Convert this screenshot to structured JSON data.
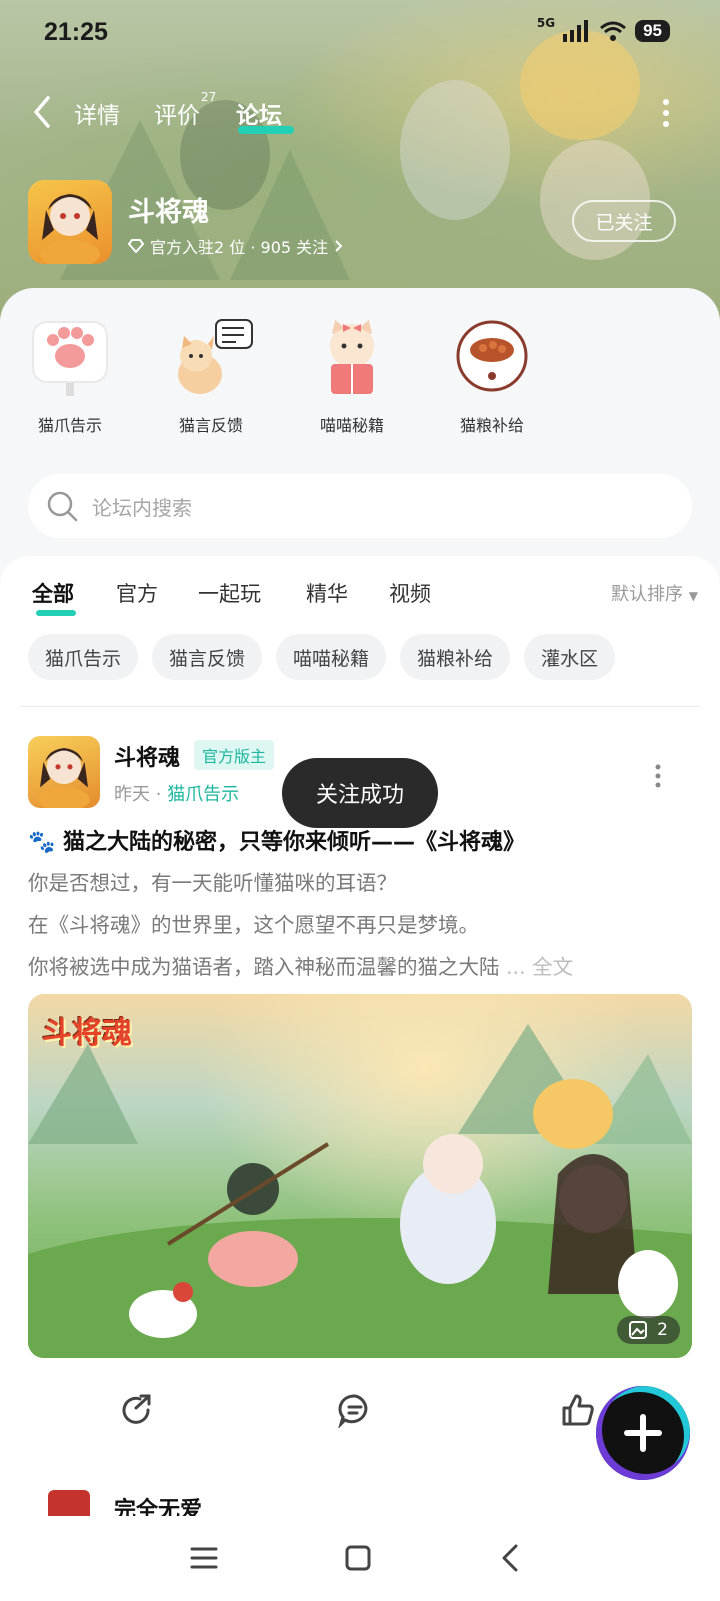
{
  "status_bar": {
    "time": "21:25",
    "network": "5G",
    "battery": "95"
  },
  "nav": {
    "tabs": [
      {
        "label": "详情"
      },
      {
        "label": "评价",
        "badge": "27"
      },
      {
        "label": "论坛"
      }
    ],
    "active_tab": "论坛"
  },
  "game": {
    "title": "斗将魂",
    "meta": "官方入驻2 位 · 905 关注",
    "follow_button": "已关注"
  },
  "shortcuts": [
    {
      "label": "猫爪告示",
      "icon": "cat-paw-sign-icon"
    },
    {
      "label": "猫言反馈",
      "icon": "cat-feedback-icon"
    },
    {
      "label": "喵喵秘籍",
      "icon": "cat-reading-book-icon"
    },
    {
      "label": "猫粮补给",
      "icon": "cat-food-bowl-icon"
    }
  ],
  "search": {
    "placeholder": "论坛内搜索"
  },
  "filter_tabs": [
    {
      "label": "全部"
    },
    {
      "label": "官方"
    },
    {
      "label": "一起玩"
    },
    {
      "label": "精华"
    },
    {
      "label": "视频"
    }
  ],
  "sort_label": "默认排序",
  "chips": [
    "猫爪告示",
    "猫言反馈",
    "喵喵秘籍",
    "猫粮补给",
    "灌水区"
  ],
  "post": {
    "author": "斗将魂",
    "badge": "官方版主",
    "time": "昨天",
    "board": "猫爪告示",
    "title": "🐾 猫之大陆的秘密，只等你来倾听——《斗将魂》",
    "lines": [
      "你是否想过，有一天能听懂猫咪的耳语？",
      "在《斗将魂》的世界里，这个愿望不再只是梦境。",
      "你将被选中成为猫语者，踏入神秘而温馨的猫之大陆"
    ],
    "more_label": "... 全文",
    "image_logo": "斗将魂",
    "image_count": "2"
  },
  "toast": "关注成功",
  "next_post": {
    "author": "完全无爱"
  },
  "colors": {
    "accent": "#23d0b6",
    "badge_text": "#1cb79e",
    "toast_bg": "#2a2a2a"
  }
}
